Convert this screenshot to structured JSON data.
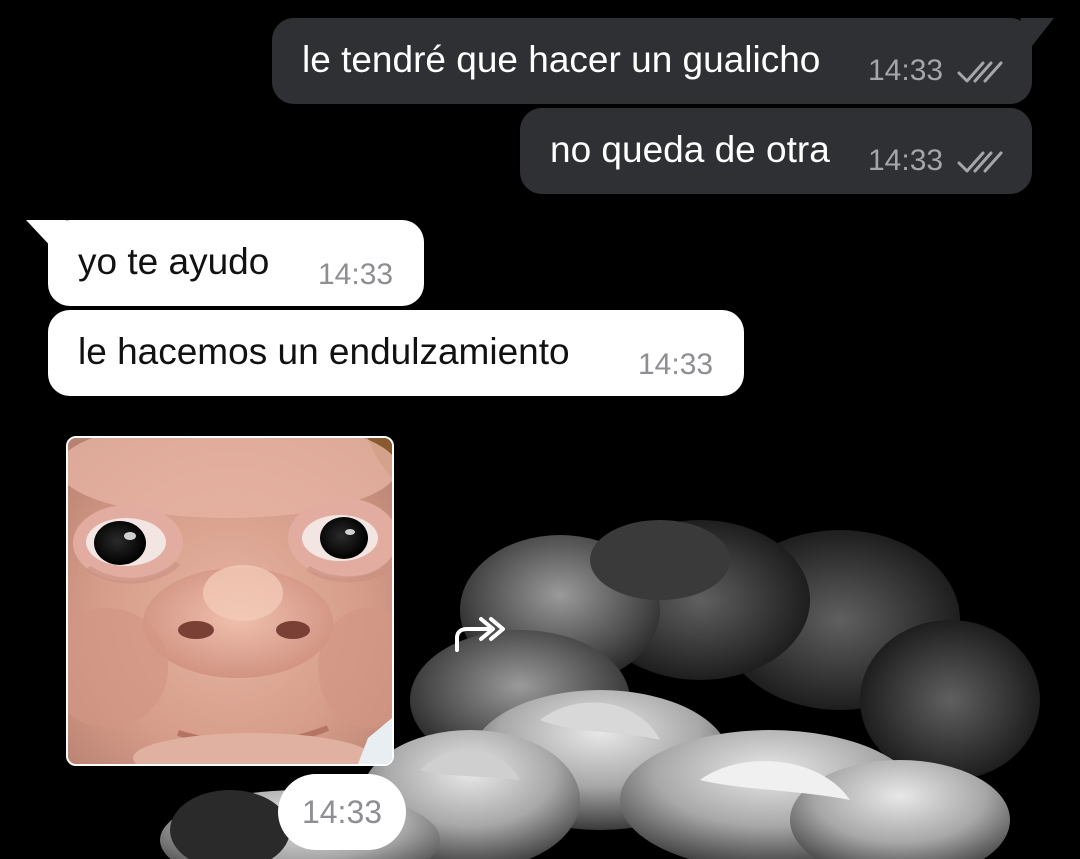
{
  "messages": [
    {
      "direction": "outgoing",
      "text": "le tendré que hacer un gualicho",
      "time": "14:33",
      "status": "read"
    },
    {
      "direction": "outgoing",
      "text": "no queda de otra",
      "time": "14:33",
      "status": "read"
    },
    {
      "direction": "incoming",
      "text": "yo te ayudo",
      "time": "14:33"
    },
    {
      "direction": "incoming",
      "text": "le hacemos un endulzamiento",
      "time": "14:33"
    }
  ],
  "photo_message": {
    "time": "14:33",
    "forward_icon": "forward-arrow-icon"
  },
  "colors": {
    "background": "#000000",
    "outgoing_bubble": "#2f3033",
    "incoming_bubble": "#ffffff",
    "outgoing_meta": "#a3a6ab",
    "incoming_meta": "#8e8e93"
  }
}
